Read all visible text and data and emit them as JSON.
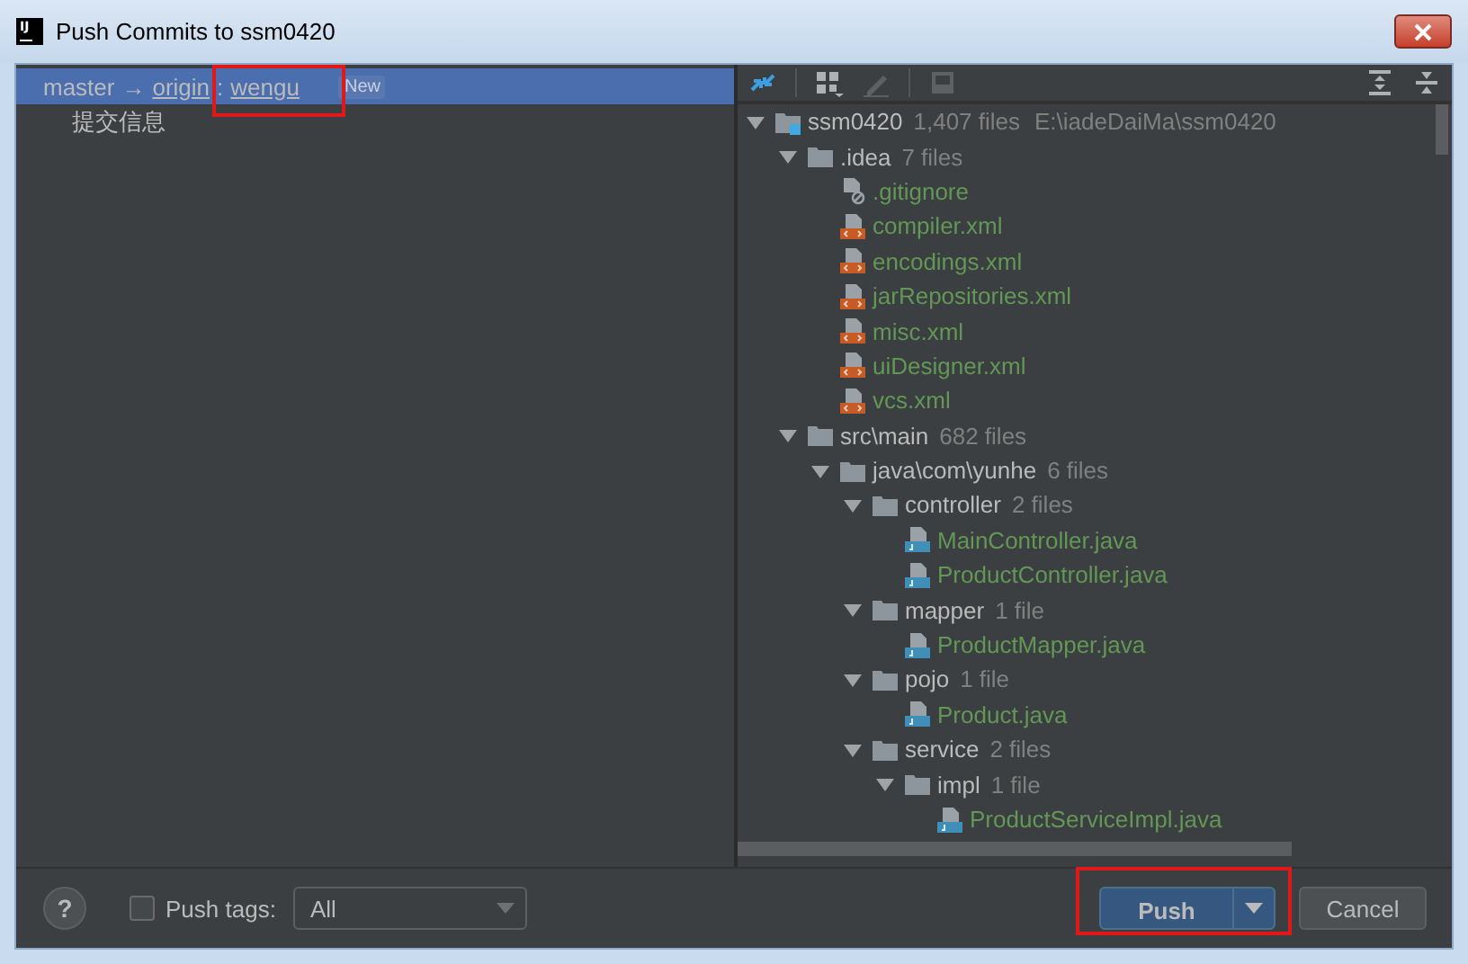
{
  "window": {
    "title": "Push Commits to ssm0420",
    "icon_label": "IJ"
  },
  "commits_panel": {
    "branch": {
      "source": "master",
      "arrow": "→",
      "remote": "origin",
      "separator": ":",
      "target": "wengu",
      "badge": "New",
      "selected": true,
      "highlighted": true
    },
    "commits": [
      {
        "message": "提交信息",
        "selected": false
      }
    ]
  },
  "tree": {
    "kind": "module",
    "name": "ssm0420",
    "count": "1,407 files",
    "path": "E:\\iadeDaiMa\\ssm0420",
    "expanded": true,
    "children": [
      {
        "kind": "folder",
        "name": ".idea",
        "count": "7 files",
        "expanded": true,
        "children": [
          {
            "kind": "ignored",
            "name": ".gitignore"
          },
          {
            "kind": "xml",
            "name": "compiler.xml"
          },
          {
            "kind": "xml",
            "name": "encodings.xml"
          },
          {
            "kind": "xml",
            "name": "jarRepositories.xml"
          },
          {
            "kind": "xml",
            "name": "misc.xml"
          },
          {
            "kind": "xml",
            "name": "uiDesigner.xml"
          },
          {
            "kind": "xml",
            "name": "vcs.xml"
          }
        ]
      },
      {
        "kind": "folder",
        "name": "src\\main",
        "count": "682 files",
        "expanded": true,
        "children": [
          {
            "kind": "folder",
            "name": "java\\com\\yunhe",
            "count": "6 files",
            "expanded": true,
            "children": [
              {
                "kind": "folder",
                "name": "controller",
                "count": "2 files",
                "expanded": true,
                "children": [
                  {
                    "kind": "java",
                    "name": "MainController.java"
                  },
                  {
                    "kind": "java",
                    "name": "ProductController.java"
                  }
                ]
              },
              {
                "kind": "folder",
                "name": "mapper",
                "count": "1 file",
                "expanded": true,
                "children": [
                  {
                    "kind": "java",
                    "name": "ProductMapper.java"
                  }
                ]
              },
              {
                "kind": "folder",
                "name": "pojo",
                "count": "1 file",
                "expanded": true,
                "children": [
                  {
                    "kind": "java",
                    "name": "Product.java"
                  }
                ]
              },
              {
                "kind": "folder",
                "name": "service",
                "count": "2 files",
                "expanded": true,
                "children": [
                  {
                    "kind": "folder",
                    "name": "impl",
                    "count": "1 file",
                    "expanded": true,
                    "children": [
                      {
                        "kind": "java",
                        "name": "ProductServiceImpl.java"
                      }
                    ]
                  }
                ]
              }
            ]
          }
        ]
      }
    ]
  },
  "footer": {
    "help": "?",
    "push_tags": {
      "label": "Push tags:",
      "checked": false
    },
    "tags_dropdown": {
      "value": "All"
    },
    "push_button": {
      "label": "Push",
      "highlighted": true
    },
    "cancel_button": {
      "label": "Cancel"
    }
  }
}
